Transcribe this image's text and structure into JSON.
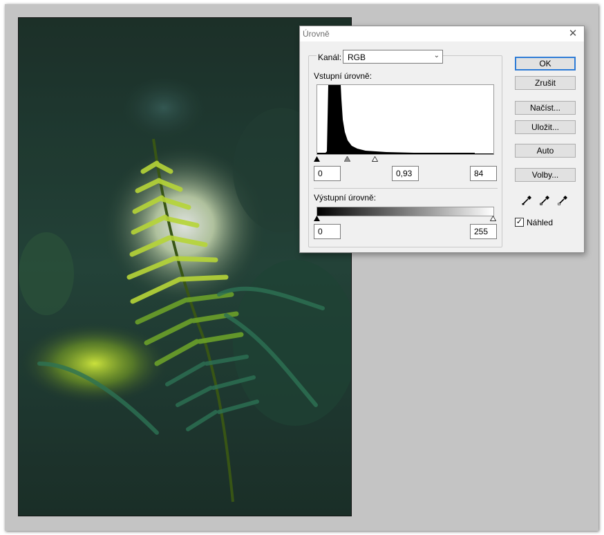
{
  "dialog": {
    "title": "Úrovně",
    "close_glyph": "✕",
    "channel_label": "Kanál:",
    "channel_value": "RGB",
    "input_levels_label": "Vstupní úrovně:",
    "input_black": "0",
    "input_gamma": "0,93",
    "input_white": "84",
    "output_levels_label": "Výstupní úrovně:",
    "output_black": "0",
    "output_white": "255",
    "preview_label": "Náhled",
    "preview_checked": true
  },
  "buttons": {
    "ok": "OK",
    "cancel": "Zrušit",
    "load": "Načíst...",
    "save": "Uložit...",
    "auto": "Auto",
    "options": "Volby..."
  },
  "icons": {
    "eyedroppers": [
      "black-point-eyedropper-icon",
      "gray-point-eyedropper-icon",
      "white-point-eyedropper-icon"
    ],
    "sliders": [
      "black-input-slider",
      "gamma-input-slider",
      "white-input-slider",
      "black-output-slider",
      "white-output-slider"
    ]
  },
  "colors": {
    "accent": "#2d7bd6",
    "workspace": "#c4c4c4",
    "dialog_bg": "#f0f0f0"
  }
}
